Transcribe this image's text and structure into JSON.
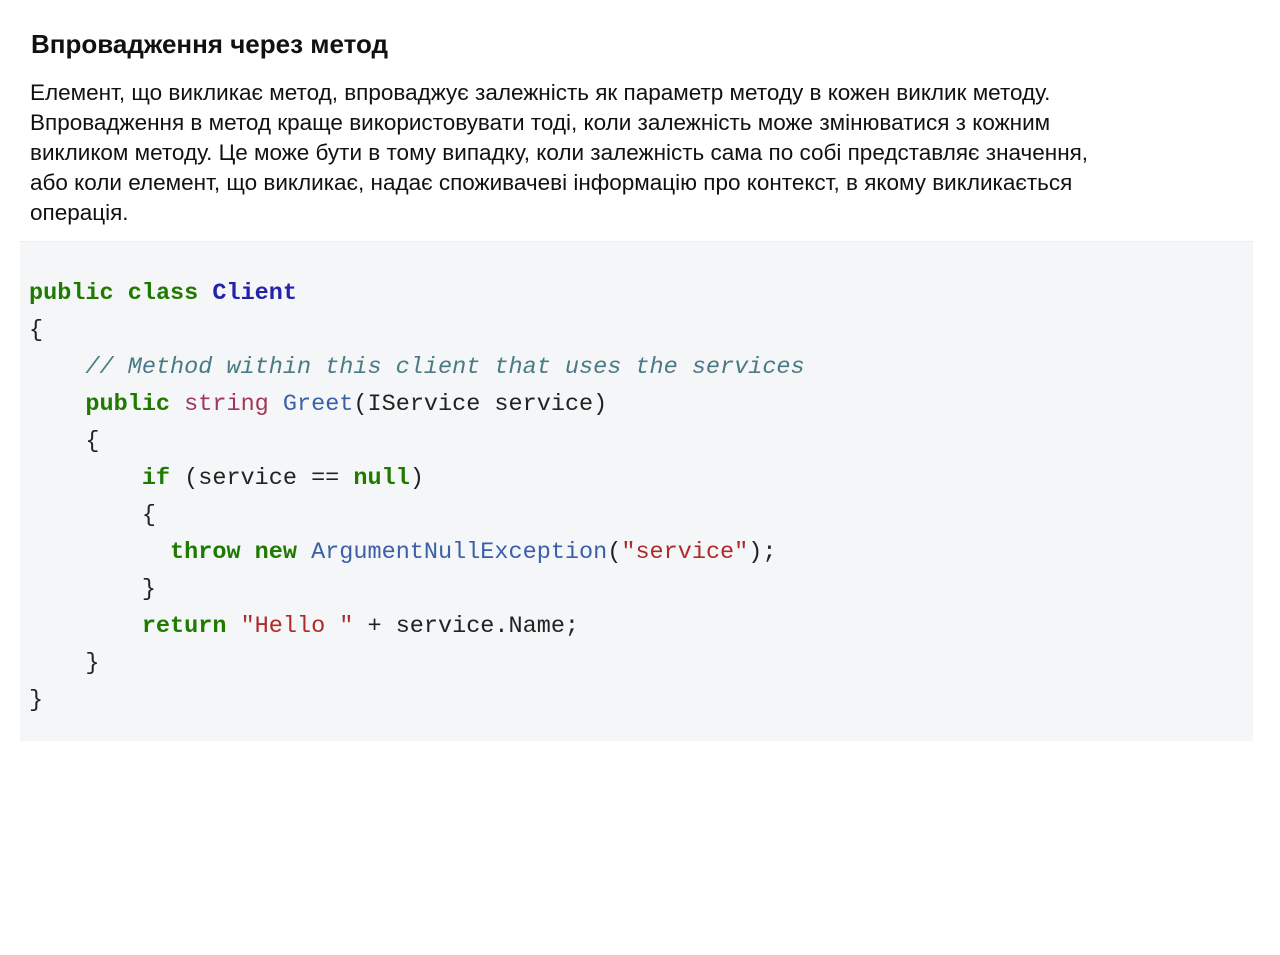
{
  "heading": "Впровадження через метод",
  "paragraph_lines": [
    "Елемент, що викликає метод, впроваджує залежність як параметр методу в кожен виклик методу.",
    "Впровадження в метод краще використовувати тоді, коли залежність може змінюватися з кожним",
    "викликом методу. Це може бути в тому випадку, коли залежність сама по собі представляє значення,",
    "або коли елемент, що викликає, надає споживачеві інформацію про контекст, в якому викликається",
    "операція."
  ],
  "code": {
    "l1": {
      "t1": "public",
      "t2": " ",
      "t3": "class",
      "t4": " ",
      "t5": "Client"
    },
    "l2": {
      "t1": "{"
    },
    "l3": {
      "t0": "    ",
      "t1": "// Method within this client that uses the services"
    },
    "l4": {
      "t0": "    ",
      "t1": "public",
      "t2": " ",
      "t3": "string",
      "t4": " ",
      "t5": "Greet",
      "t6": "(IService service)"
    },
    "l5": {
      "t0": "    ",
      "t1": "{"
    },
    "l6": {
      "t0": "        ",
      "t1": "if",
      "t2": " (service == ",
      "t3": "null",
      "t4": ")"
    },
    "l7": {
      "t0": "        ",
      "t1": "{"
    },
    "l8": {
      "t0": "          ",
      "t1": "throw",
      "t2": " ",
      "t3": "new",
      "t4": " ",
      "t5": "ArgumentNullException",
      "t6": "(",
      "t7": "\"service\"",
      "t8": ");"
    },
    "l9": {
      "t0": "        ",
      "t1": "}"
    },
    "l10": {
      "t0": "        ",
      "t1": "return",
      "t2": " ",
      "t3": "\"Hello \"",
      "t4": " + service.Name;"
    },
    "l11": {
      "t0": "    ",
      "t1": "}"
    },
    "l12": {
      "t1": "}"
    }
  }
}
